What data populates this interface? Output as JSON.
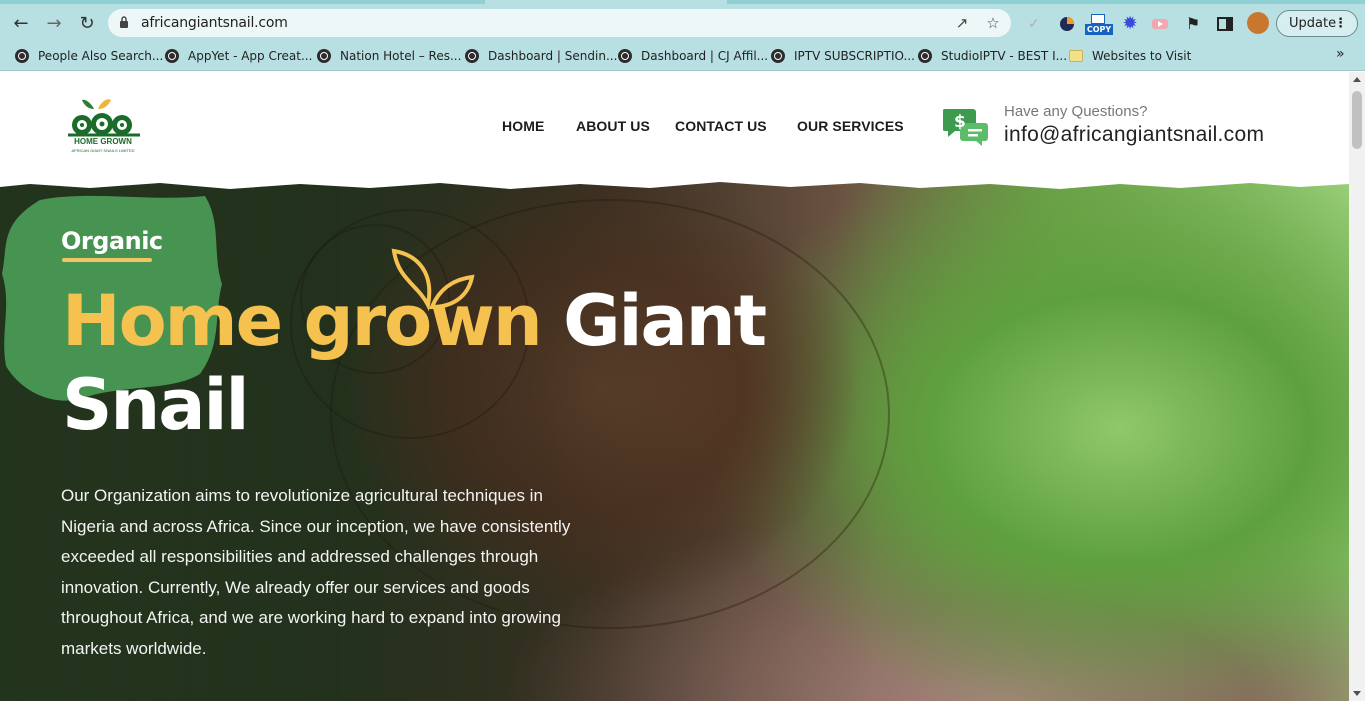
{
  "browser": {
    "url": "africangiantsnail.com",
    "update_label": "Update",
    "bookmarks": [
      {
        "label": "People Also Search...",
        "icon": "globe-icon"
      },
      {
        "label": "AppYet - App Creat...",
        "icon": "globe-icon"
      },
      {
        "label": "Nation Hotel – Res...",
        "icon": "globe-icon"
      },
      {
        "label": "Dashboard | Sendin...",
        "icon": "globe-icon"
      },
      {
        "label": "Dashboard | CJ Affil...",
        "icon": "globe-icon"
      },
      {
        "label": "IPTV SUBSCRIPTIO...",
        "icon": "globe-icon"
      },
      {
        "label": "StudioIPTV - BEST I...",
        "icon": "globe-icon"
      },
      {
        "label": "Websites to Visit",
        "icon": "folder-icon"
      }
    ],
    "extensions": {
      "copy_label": "COPY"
    }
  },
  "header": {
    "logo_line1": "HOME GROWN",
    "logo_line2": "AFRICAN GIANT SNAILS LIMITED",
    "nav": [
      "HOME",
      "ABOUT US",
      "CONTACT US",
      "OUR SERVICES"
    ],
    "contact_question": "Have any Questions?",
    "contact_email": "info@africangiantsnail.com"
  },
  "hero": {
    "tag": "Organic",
    "headline_gold": "Home grown",
    "headline_white1": "Giant",
    "headline_white2": "Snail",
    "body": "Our Organization aims to revolutionize agricultural techniques in Nigeria and across Africa. Since our inception, we have consistently exceeded all responsibilities and addressed challenges through innovation. Currently, We already offer our services and goods throughout Africa, and we are working hard to expand into growing markets worldwide."
  },
  "colors": {
    "browser_chrome": "#b8e0e3",
    "brand_green": "#4a9a55",
    "brand_gold": "#f5c24f",
    "text_dark": "#1c1c1c"
  }
}
